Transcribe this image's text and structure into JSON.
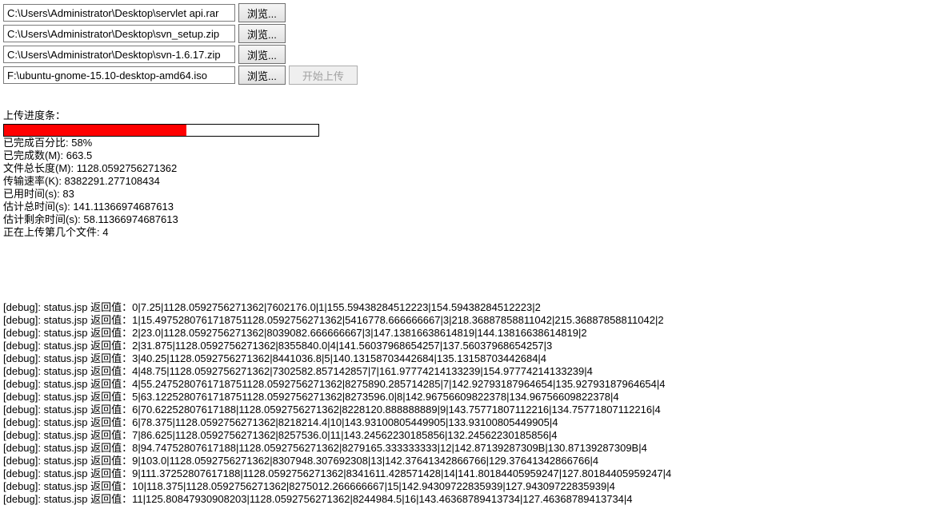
{
  "files": [
    {
      "path": "C:\\Users\\Administrator\\Desktop\\servlet api.rar",
      "browse": "浏览..."
    },
    {
      "path": "C:\\Users\\Administrator\\Desktop\\svn_setup.zip",
      "browse": "浏览..."
    },
    {
      "path": "C:\\Users\\Administrator\\Desktop\\svn-1.6.17.zip",
      "browse": "浏览..."
    },
    {
      "path": "F:\\ubuntu-gnome-15.10-desktop-amd64.iso",
      "browse": "浏览...",
      "upload": "开始上传"
    }
  ],
  "progress": {
    "label": "上传进度条：",
    "percent": 58,
    "stats": {
      "percentLine": "已完成百分比: 58%",
      "completedM": "已完成数(M): 663.5",
      "totalLengthM": "文件总长度(M): 1128.0592756271362",
      "rateK": "传输速率(K): 8382291.277108434",
      "elapsedS": "已用时间(s): 83",
      "estTotalS": "估计总时间(s): 141.11366974687613",
      "estRemainS": "估计剩余时间(s): 58.11366974687613",
      "fileIndex": "正在上传第几个文件: 4"
    }
  },
  "debugPrefix": "[debug]: status.jsp 返回值：",
  "debugLines": [
    "0|7.25|1128.0592756271362|7602176.0|1|155.59438284512223|154.59438284512223|2",
    "1|15.4975280761718751128.0592756271362|5416778.666666667|3|218.36887858811042|215.36887858811042|2",
    "2|23.0|1128.0592756271362|8039082.666666667|3|147.13816638614819|144.13816638614819|2",
    "2|31.875|1128.0592756271362|8355840.0|4|141.56037968654257|137.56037968654257|3",
    "3|40.25|1128.0592756271362|8441036.8|5|140.13158703442684|135.13158703442684|4",
    "4|48.75|1128.0592756271362|7302582.857142857|7|161.97774214133239|154.97774214133239|4",
    "4|55.2475280761718751128.0592756271362|8275890.285714285|7|142.92793187964654|135.92793187964654|4",
    "5|63.1225280761718751128.0592756271362|8273596.0|8|142.96756609822378|134.96756609822378|4",
    "6|70.62252807617188|1128.0592756271362|8228120.888888889|9|143.75771807112216|134.75771807112216|4",
    "6|78.375|1128.0592756271362|8218214.4|10|143.93100805449905|133.93100805449905|4",
    "7|86.625|1128.0592756271362|8257536.0|11|143.24562230185856|132.24562230185856|4",
    "8|94.74752807617188|1128.0592756271362|8279165.333333333|12|142.87139287309B|130.87139287309B|4",
    "9|103.0|1128.0592756271362|8307948.307692308|13|142.37641342866766|129.37641342866766|4",
    "9|111.37252807617188|1128.0592756271362|8341611.428571428|14|141.80184405959247|127.80184405959247|4",
    "10|118.375|1128.0592756271362|8275012.266666667|15|142.94309722835939|127.94309722835939|4",
    "11|125.80847930908203|1128.0592756271362|8244984.5|16|143.46368789413734|127.46368789413734|4"
  ]
}
